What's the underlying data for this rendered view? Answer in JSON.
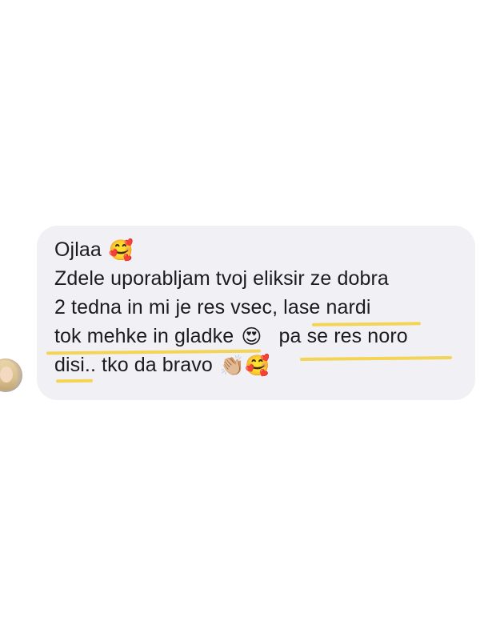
{
  "message": {
    "lines": [
      {
        "text": "Ojlaa",
        "emoji": "🥰"
      },
      {
        "text": "Zdele uporabljam tvoj eliksir ze dobra"
      },
      {
        "text": "2 tedna in mi je res vsec, lase nardi"
      },
      {
        "text": "tok mehke in gladke",
        "emoji": "😍",
        "text_after": "pa se res noro"
      },
      {
        "text": "disi.. tko da bravo",
        "emoji": "👏🏼🥰"
      }
    ]
  },
  "colors": {
    "bubble": "#f1f0f5",
    "text": "#1c1c1e",
    "highlight": "#f2d24c",
    "background": "#ffffff"
  },
  "icons": {
    "avatar": "user-avatar-photo"
  }
}
